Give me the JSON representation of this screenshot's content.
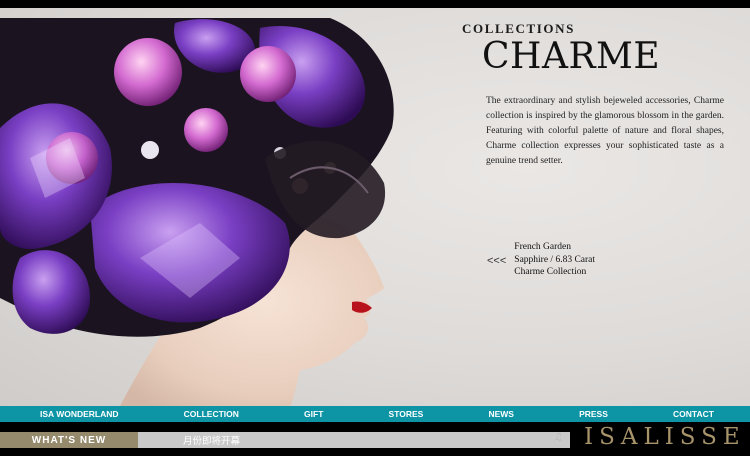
{
  "header": {
    "label": "COLLECTIONS",
    "title": "CHARME"
  },
  "description": "The extraordinary and stylish bejeweled accessories, Charme collection is inspired by the glamorous blossom in the garden. Featuring with colorful palette of nature and floral shapes, Charme collection expresses your sophisticated taste as a genuine trend setter.",
  "caption": {
    "arrows": "<<<",
    "line1": "French Garden",
    "line2": "Sapphire / 6.83 Carat",
    "line3": "Charme Collection"
  },
  "nav": {
    "items": [
      "ISA WONDERLAND",
      "COLLECTION",
      "GIFT",
      "STORES",
      "NEWS",
      "PRESS",
      "CONTACT"
    ]
  },
  "footer": {
    "whats_new": "WHAT'S NEW",
    "ticker": "月份即将开幕",
    "brand": "ISALISSE"
  },
  "icons": [
    "music-note-icon",
    "back-arrows-icon"
  ],
  "colors": {
    "nav_bg": "#0d95a6",
    "whats_new_bg": "#958a6c",
    "brand_gold": "#a8946a"
  }
}
